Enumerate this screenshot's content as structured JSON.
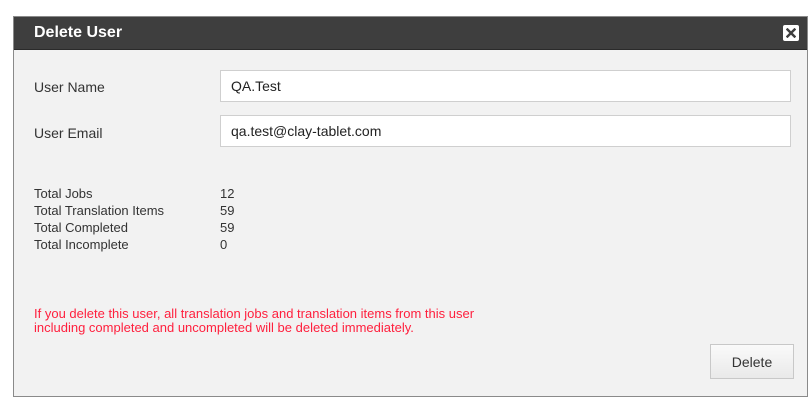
{
  "dialog": {
    "title": "Delete User",
    "close_icon": "close-icon"
  },
  "form": {
    "user_name_label": "User Name",
    "user_name_value": "QA.Test",
    "user_email_label": "User Email",
    "user_email_value": "qa.test@clay-tablet.com"
  },
  "stats": [
    {
      "label": "Total Jobs",
      "value": "12"
    },
    {
      "label": "Total Translation Items",
      "value": "59"
    },
    {
      "label": "Total Completed",
      "value": "59"
    },
    {
      "label": "Total Incomplete",
      "value": "0"
    }
  ],
  "warning": {
    "line1": "If you delete this user, all translation jobs and translation items from this user",
    "line2": "including completed and uncompleted will be deleted immediately."
  },
  "actions": {
    "delete_label": "Delete"
  },
  "colors": {
    "titlebar": "#3e3e3e",
    "panel": "#f2f2f2",
    "warning": "#ff1f3d"
  }
}
